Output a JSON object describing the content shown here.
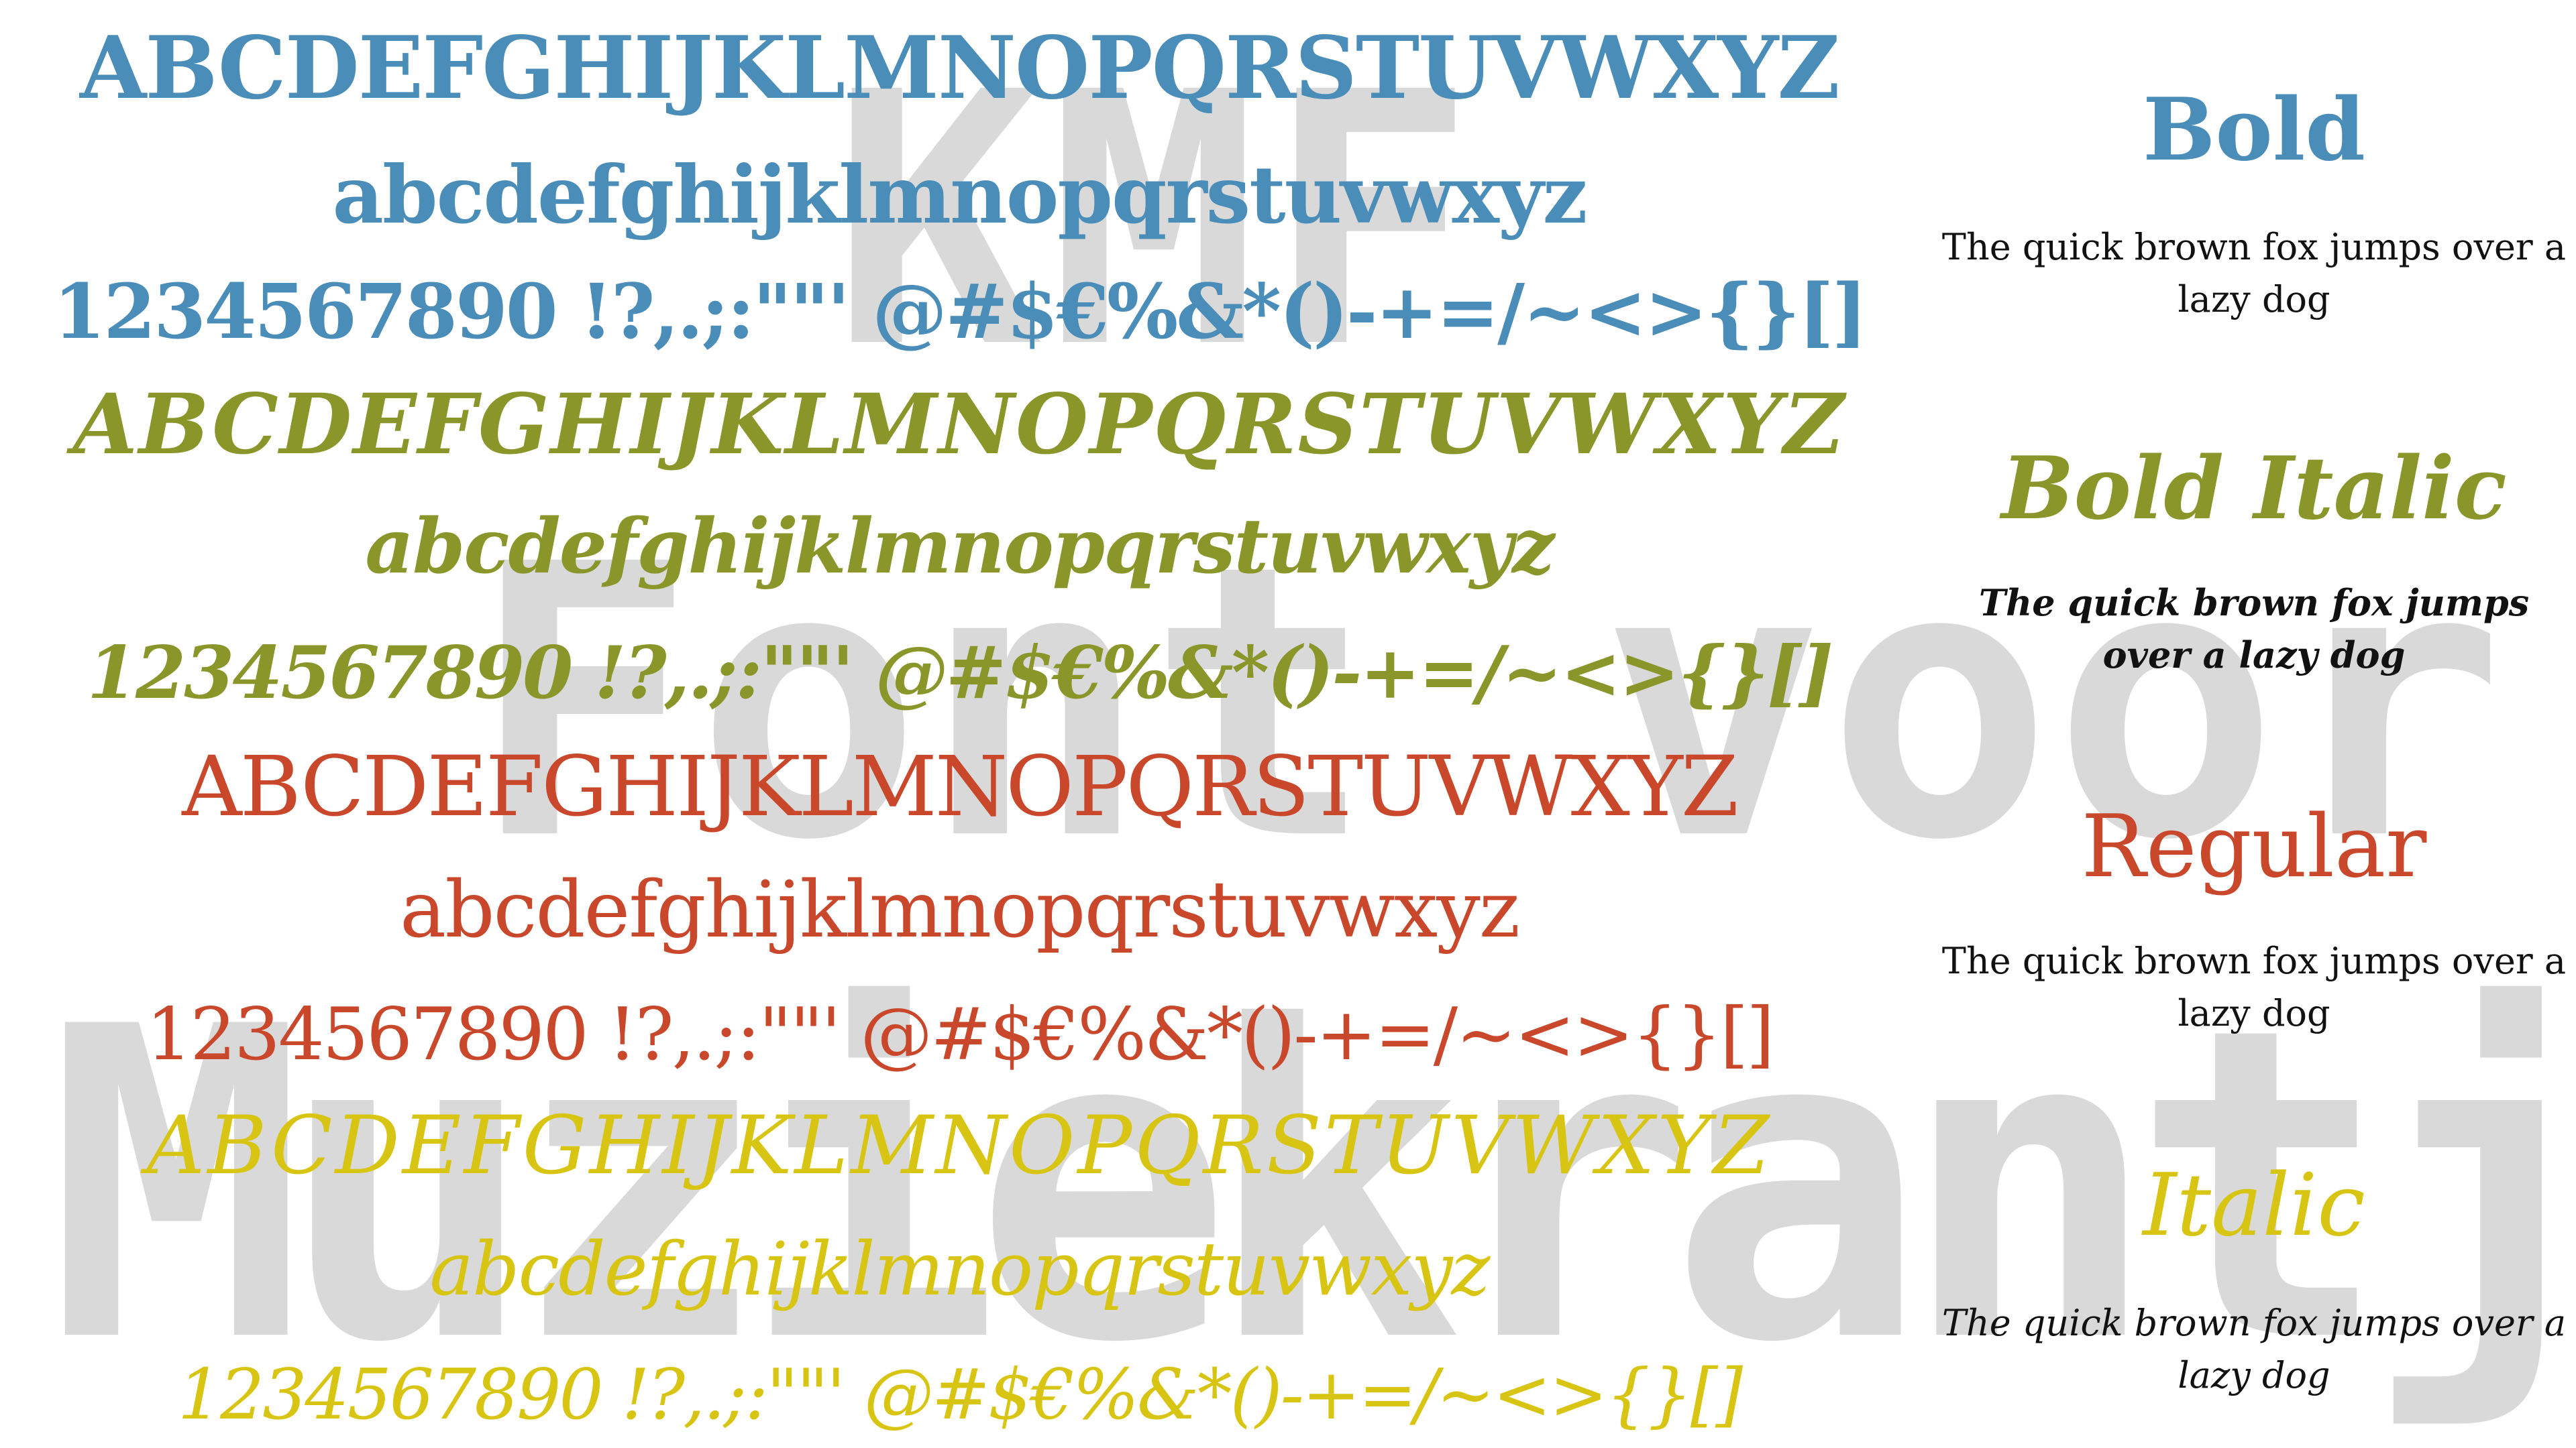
{
  "watermark": {
    "line1": "KMF",
    "line2": "Font voor",
    "line3": "Muziekrantje"
  },
  "specimens": {
    "uppercase": "ABCDEFGHIJKLMNOPQRSTUVWXYZ",
    "lowercase": "abcdefghijklmnopqrstuvwxyz",
    "figures": "1234567890 !?,.;:\"\"' @#$€%&*()-+=/~<>{}[]"
  },
  "styles": [
    {
      "name": "Bold",
      "pangram": "The quick brown fox jumps over a lazy dog"
    },
    {
      "name": "Bold Italic",
      "pangram": "The quick brown fox jumps over a lazy dog"
    },
    {
      "name": "Regular",
      "pangram": "The quick brown fox jumps over a lazy dog"
    },
    {
      "name": "Italic",
      "pangram": "The quick brown fox jumps over a lazy dog"
    }
  ],
  "colors": {
    "bold": "#4a8db9",
    "bold_italic": "#8a962a",
    "regular": "#c9482c",
    "italic": "#d8c513",
    "watermark": "#d9d9d9",
    "pangram": "#111111"
  }
}
